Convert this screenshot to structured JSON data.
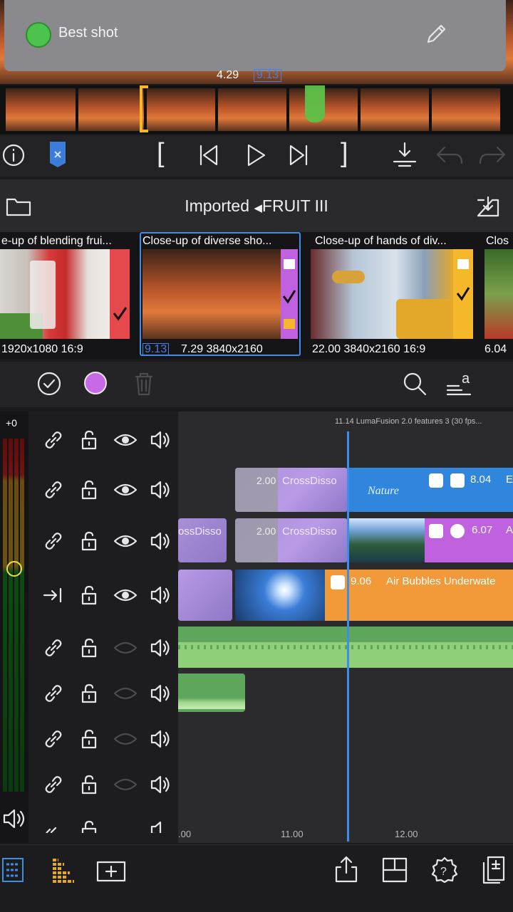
{
  "note_bar": {
    "title": "Best shot",
    "color": "#4cc34c"
  },
  "playhead_time": "4.29",
  "playhead_sub": "9.13",
  "transport": {
    "info_icon": "info-icon",
    "marker_icon": "marker-flag-icon",
    "mark_in": "[",
    "mark_out": "]"
  },
  "library": {
    "source": "Imported",
    "folder": "FRUIT III",
    "clips": [
      {
        "title": "e-up of blending frui...",
        "info": "1920x1080  16:9",
        "tag_color": "#e5484d"
      },
      {
        "title": "Close-up of diverse sho...",
        "sub": "9.13",
        "info": "7.29  3840x2160",
        "tag_color": "#c062e0"
      },
      {
        "title": "Close-up of hands of div...",
        "info": "22.00  3840x2160  16:9",
        "tag_color": "#f5b82a"
      },
      {
        "title": "Clos",
        "info": "6.04"
      }
    ]
  },
  "filter_row": {
    "color_dot": "#c86ae8"
  },
  "meter": {
    "level_label": "+0"
  },
  "project_label": "11.14  LumaFusion 2.0 features 3 (30 fps...",
  "tracks": {
    "clips": {
      "crossdiss_1": "CrossDisso",
      "crossdiss_1_time": "2.00",
      "nature_title": "Nature",
      "nature_time": "8.04",
      "nature_suffix": "E",
      "crossdiss_2_left": "ossDisso",
      "crossdiss_2": "CrossDisso",
      "crossdiss_2_time": "2.00",
      "lake_time": "6.07",
      "lake_suffix": "A",
      "bubbles_time": "9.06",
      "bubbles_title": "Air Bubbles Underwate"
    }
  },
  "ruler": {
    "ticks": [
      ".00",
      "11.00",
      "12.00"
    ]
  },
  "bottom_toolbar": {
    "icons": [
      "tracks-list-icon",
      "timeline-icon",
      "add-title-icon",
      "share-icon",
      "layout-icon",
      "settings-icon",
      "export-frame-icon"
    ]
  },
  "colors": {
    "accent_blue": "#2f86dc",
    "purple_clip": "#b78fe0",
    "orange_clip": "#f29a3a",
    "green_audio": "#5ea65c"
  }
}
